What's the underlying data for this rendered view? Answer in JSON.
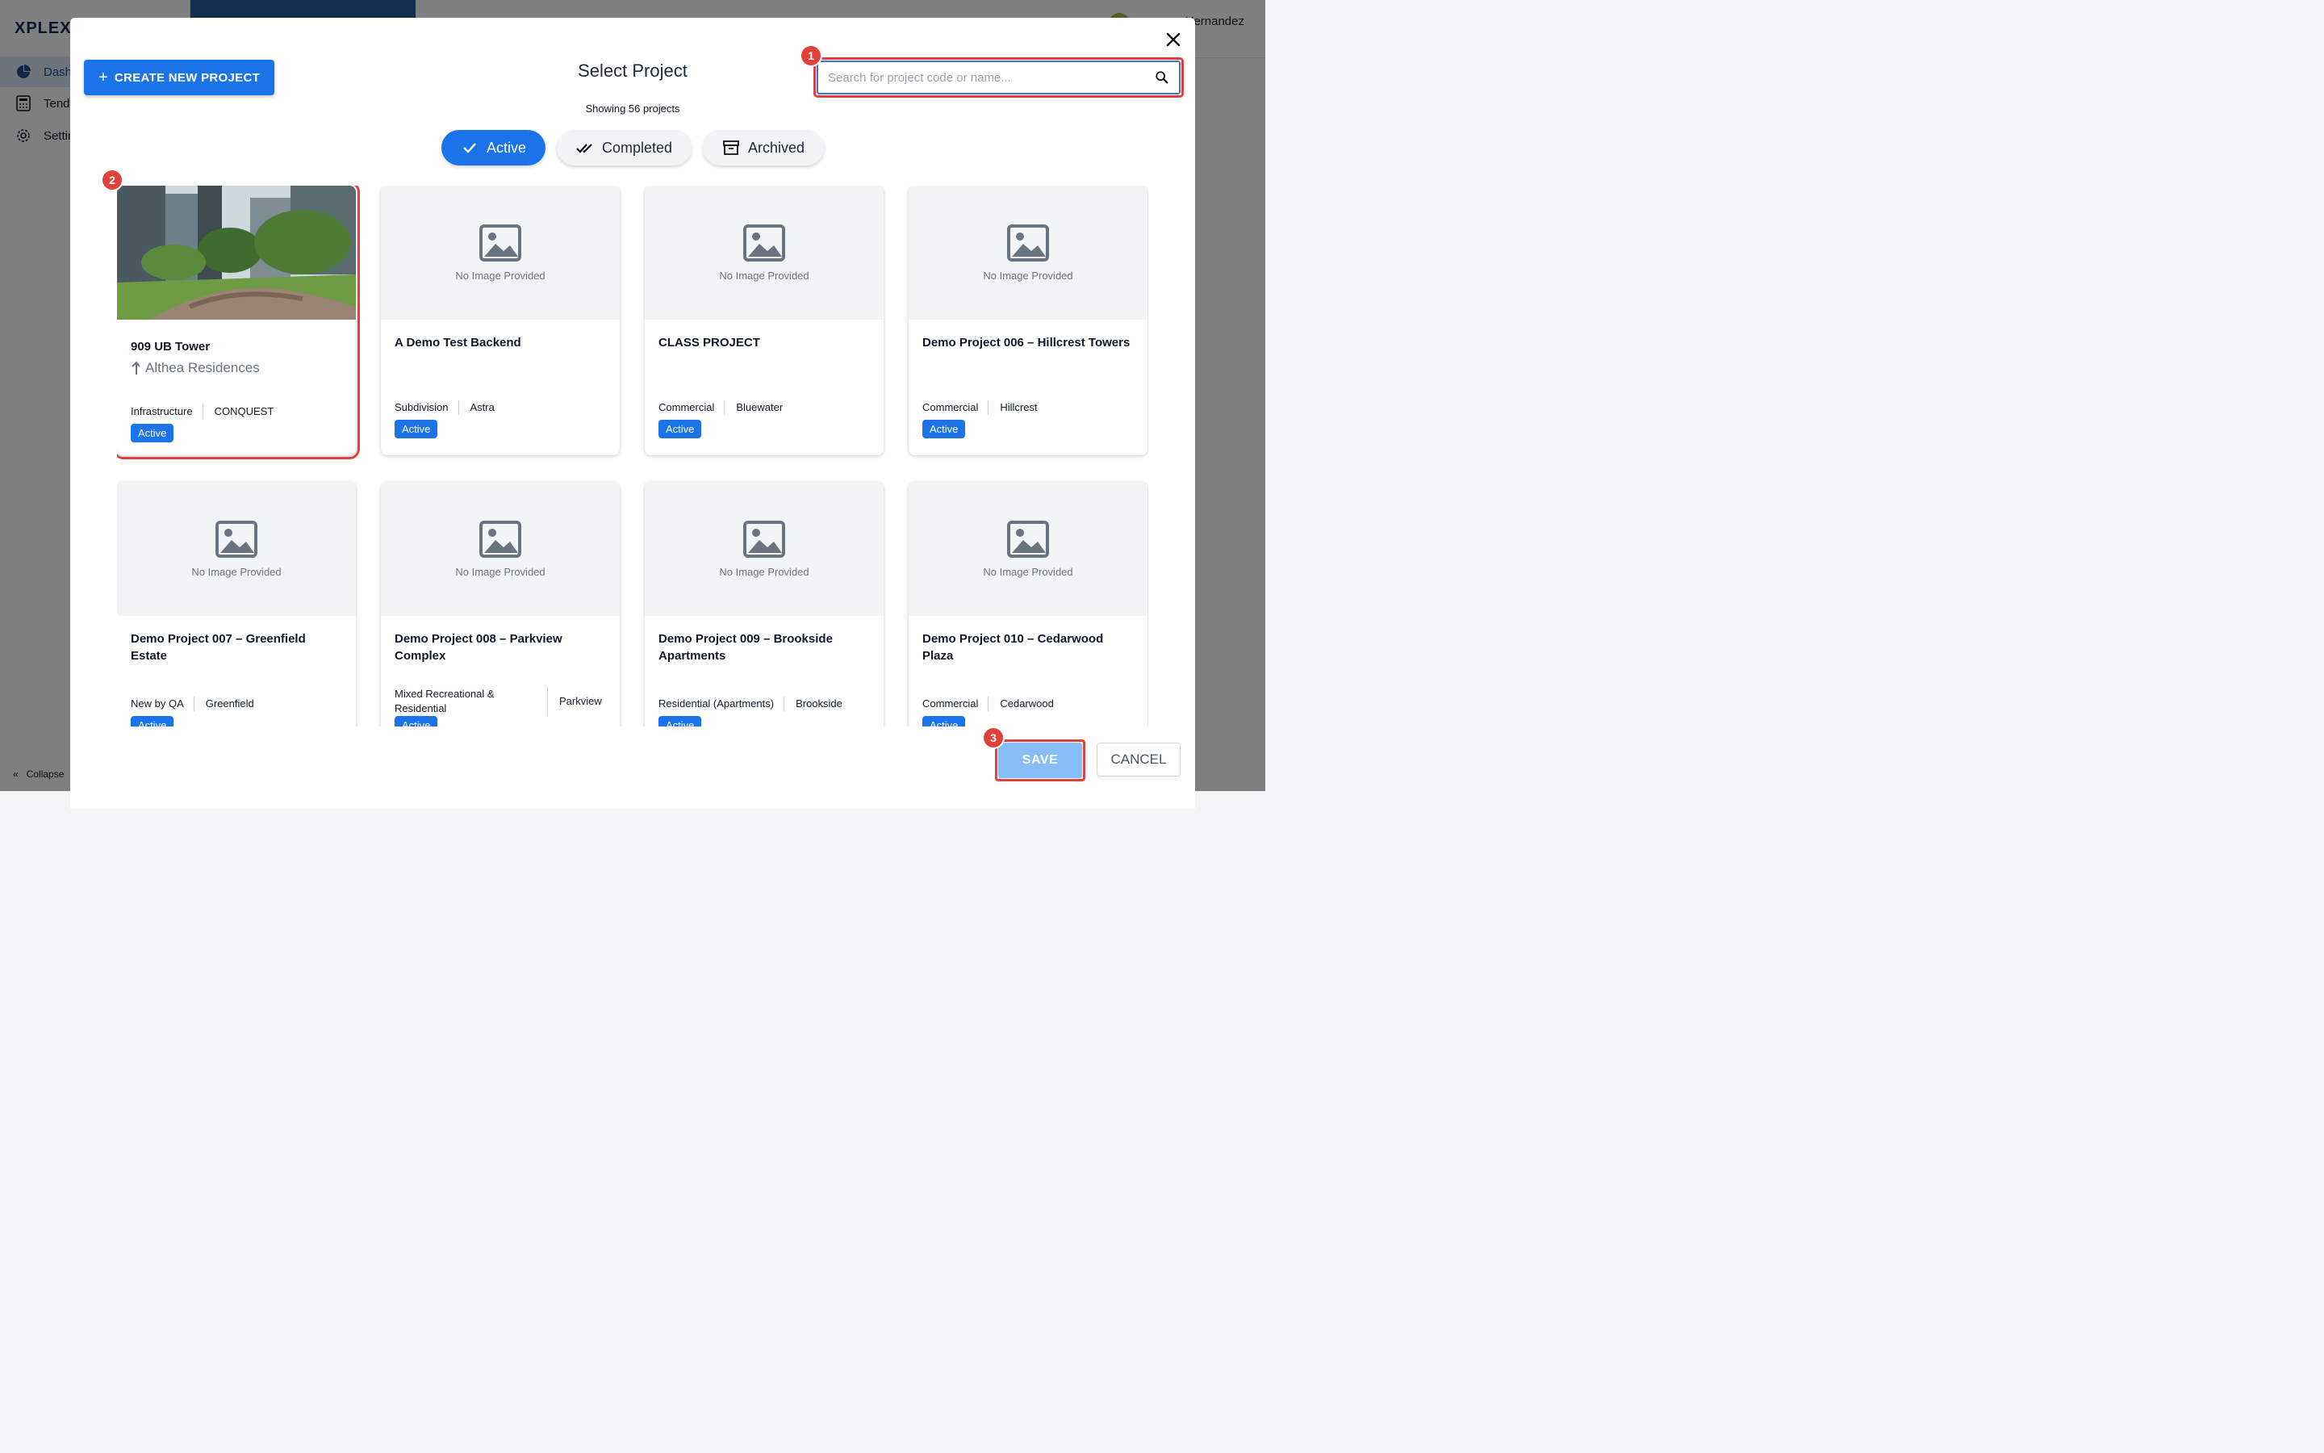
{
  "app": {
    "logo": "XPLEX",
    "user_name": "Hernandez",
    "nav_items": [
      {
        "label": "Dashboard",
        "icon": "pie-chart-icon"
      },
      {
        "label": "Tenders",
        "icon": "calculator-icon"
      },
      {
        "label": "Settings",
        "icon": "gear-icon"
      }
    ],
    "collapse_label": "Collapse"
  },
  "modal": {
    "title": "Select Project",
    "showing": "Showing 56 projects",
    "create_label": "CREATE NEW PROJECT",
    "search_placeholder": "Search for project code or name...",
    "tabs": [
      {
        "label": "Active",
        "icon": "check-icon",
        "active": true
      },
      {
        "label": "Completed",
        "icon": "double-check-icon",
        "active": false
      },
      {
        "label": "Archived",
        "icon": "archive-icon",
        "active": false
      }
    ],
    "no_image_label": "No Image Provided",
    "save_label": "SAVE",
    "cancel_label": "CANCEL",
    "annotations": [
      "1",
      "2",
      "3"
    ]
  },
  "projects": [
    {
      "name": "909 UB Tower",
      "sub": "Althea Residences",
      "category": "Infrastructure",
      "location": "CONQUEST",
      "status": "Active",
      "has_image": true
    },
    {
      "name": "A Demo Test Backend",
      "category": "Subdivision",
      "location": "Astra",
      "status": "Active",
      "has_image": false
    },
    {
      "name": "CLASS PROJECT",
      "category": "Commercial",
      "location": "Bluewater",
      "status": "Active",
      "has_image": false
    },
    {
      "name": "Demo Project 006 – Hillcrest Towers",
      "category": "Commercial",
      "location": "Hillcrest",
      "status": "Active",
      "has_image": false
    },
    {
      "name": "Demo Project 007 – Greenfield Estate",
      "category": "New by QA",
      "location": "Greenfield",
      "status": "Active",
      "has_image": false
    },
    {
      "name": "Demo Project 008 – Parkview Complex",
      "category": "Mixed Recreational & Residential",
      "location": "Parkview",
      "status": "Active",
      "has_image": false
    },
    {
      "name": "Demo Project 009 – Brookside Apartments",
      "category": "Residential (Apartments)",
      "location": "Brookside",
      "status": "Active",
      "has_image": false
    },
    {
      "name": "Demo Project 010 – Cedarwood Plaza",
      "category": "Commercial",
      "location": "Cedarwood",
      "status": "Active",
      "has_image": false
    }
  ]
}
